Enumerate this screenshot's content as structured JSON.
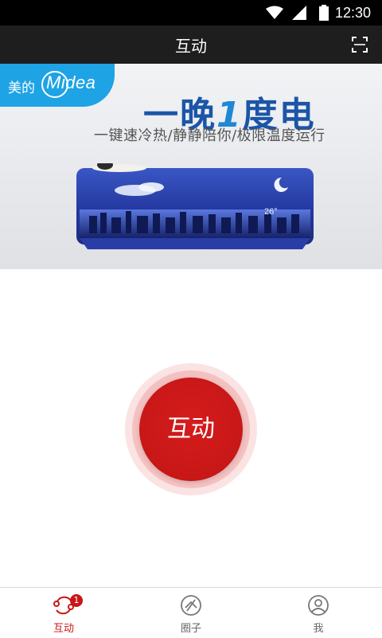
{
  "status_bar": {
    "time": "12:30"
  },
  "title_bar": {
    "title": "互动",
    "scan_icon": "scan-icon"
  },
  "banner": {
    "brand_cn": "美的",
    "brand_en": "Midea",
    "headline_part1": "一晚",
    "headline_number": "1",
    "headline_part2": "度电",
    "subline": "一键速冷热/静静陪你/极限温度运行",
    "ac_display": "26°"
  },
  "center_button": {
    "label": "互动"
  },
  "bottom_nav": {
    "items": [
      {
        "label": "互动",
        "icon": "interact-icon",
        "badge": "1",
        "active": true
      },
      {
        "label": "圈子",
        "icon": "circle-icon",
        "active": false
      },
      {
        "label": "我",
        "icon": "profile-icon",
        "active": false
      }
    ]
  },
  "colors": {
    "accent": "#c81717",
    "brand": "#1ea3e5",
    "title_bar": "#1e1e1e"
  }
}
